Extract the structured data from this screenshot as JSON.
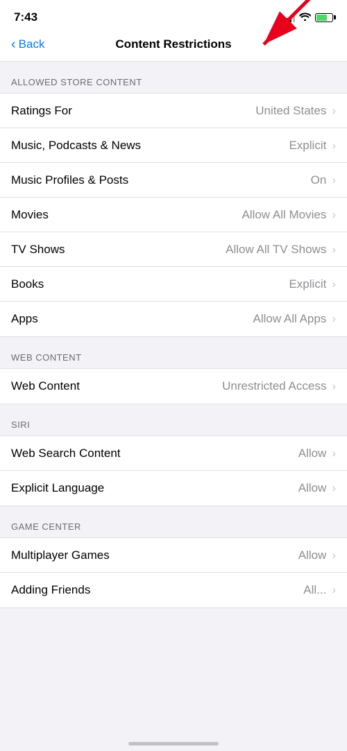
{
  "statusBar": {
    "time": "7:43",
    "battery": "70"
  },
  "navBar": {
    "backLabel": "Back",
    "title": "Content Restrictions"
  },
  "sections": [
    {
      "id": "allowed-store-content",
      "header": "ALLOWED STORE CONTENT",
      "rows": [
        {
          "id": "ratings-for",
          "label": "Ratings For",
          "value": "United States"
        },
        {
          "id": "music-podcasts",
          "label": "Music, Podcasts & News",
          "value": "Explicit"
        },
        {
          "id": "music-profiles",
          "label": "Music Profiles & Posts",
          "value": "On"
        },
        {
          "id": "movies",
          "label": "Movies",
          "value": "Allow All Movies"
        },
        {
          "id": "tv-shows",
          "label": "TV Shows",
          "value": "Allow All TV Shows"
        },
        {
          "id": "books",
          "label": "Books",
          "value": "Explicit"
        },
        {
          "id": "apps",
          "label": "Apps",
          "value": "Allow All Apps"
        }
      ]
    },
    {
      "id": "web-content",
      "header": "WEB CONTENT",
      "rows": [
        {
          "id": "web-content-row",
          "label": "Web Content",
          "value": "Unrestricted Access"
        }
      ]
    },
    {
      "id": "siri",
      "header": "SIRI",
      "rows": [
        {
          "id": "web-search-content",
          "label": "Web Search Content",
          "value": "Allow"
        },
        {
          "id": "explicit-language",
          "label": "Explicit Language",
          "value": "Allow"
        }
      ]
    },
    {
      "id": "game-center",
      "header": "GAME CENTER",
      "rows": [
        {
          "id": "multiplayer-games",
          "label": "Multiplayer Games",
          "value": "Allow"
        },
        {
          "id": "adding-friends",
          "label": "Adding Friends",
          "value": "All..."
        }
      ]
    }
  ]
}
